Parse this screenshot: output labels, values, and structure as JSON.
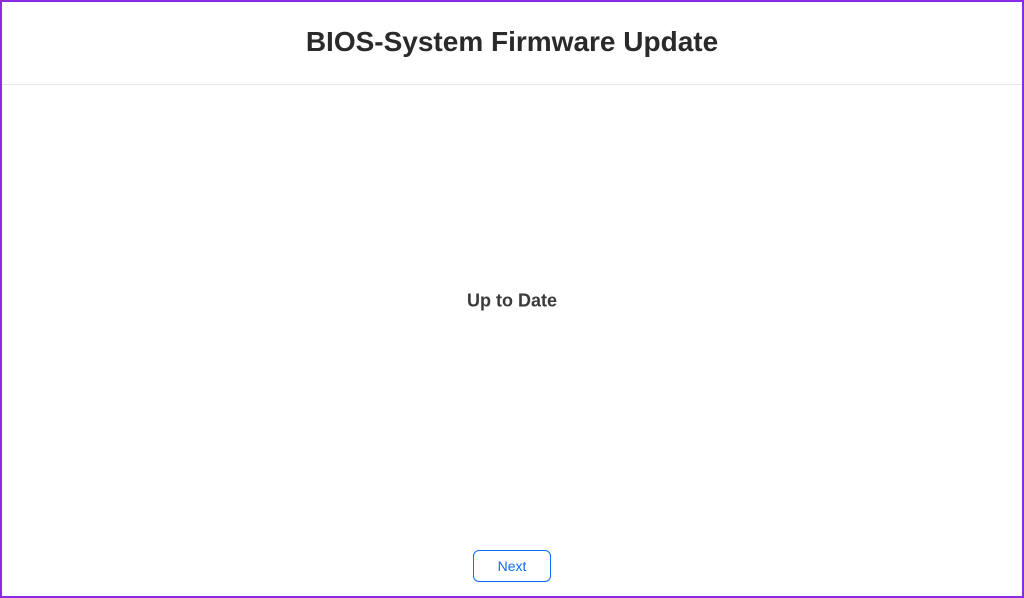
{
  "header": {
    "title": "BIOS-System Firmware Update"
  },
  "content": {
    "status": "Up to Date"
  },
  "footer": {
    "next_label": "Next"
  }
}
